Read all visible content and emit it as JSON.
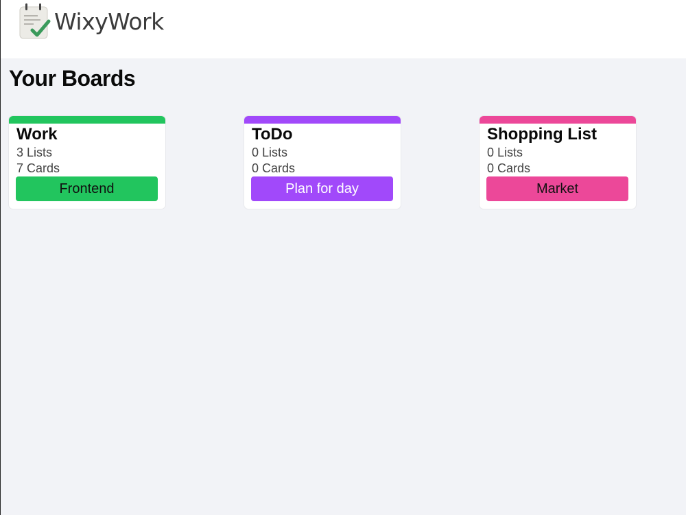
{
  "app": {
    "name": "WixyWork",
    "logo_icon": "notepad-check-icon"
  },
  "page": {
    "title": "Your Boards"
  },
  "boards": [
    {
      "name": "Work",
      "lists": "3 Lists",
      "cards": "7 Cards",
      "tag": "Frontend",
      "color": "#22c55e",
      "tag_text_color": "#111111"
    },
    {
      "name": "ToDo",
      "lists": "0 Lists",
      "cards": "0 Cards",
      "tag": "Plan for day",
      "color": "#a149fa",
      "tag_text_color": "#ffffff"
    },
    {
      "name": "Shopping List",
      "lists": "0 Lists",
      "cards": "0 Cards",
      "tag": "Market",
      "color": "#ec4899",
      "tag_text_color": "#111111"
    }
  ]
}
